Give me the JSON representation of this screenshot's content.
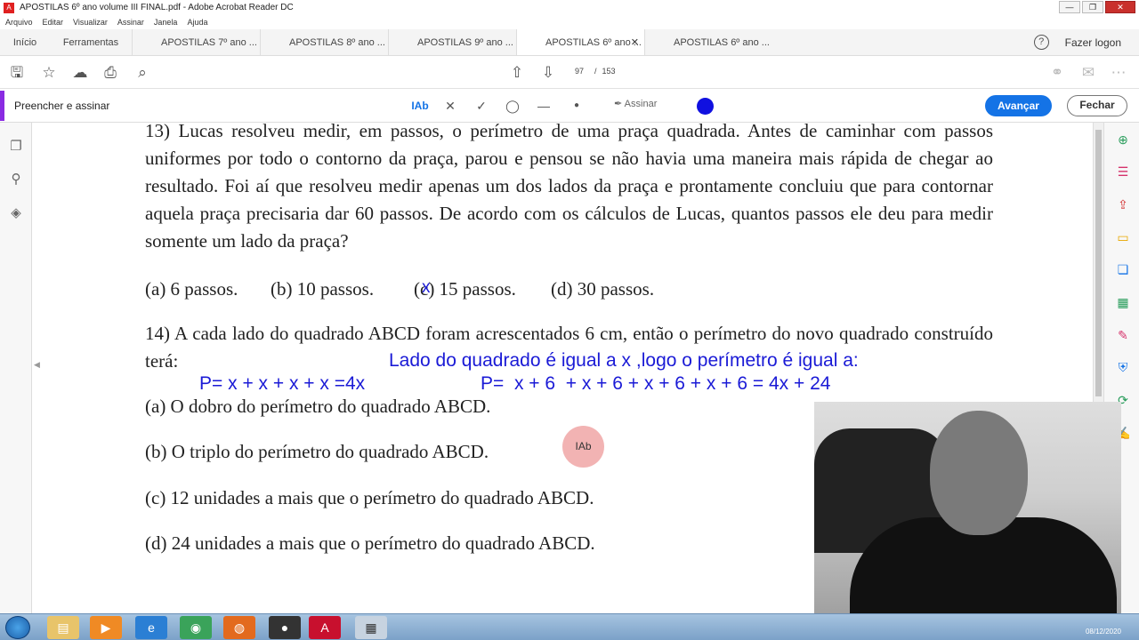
{
  "window": {
    "title": "APOSTILAS 6º ano volume III FINAL.pdf - Adobe Acrobat Reader DC",
    "buttons": [
      "—",
      "❐",
      "✕"
    ]
  },
  "menu": [
    "Arquivo",
    "Editar",
    "Visualizar",
    "Assinar",
    "Janela",
    "Ajuda"
  ],
  "tabs": {
    "home": "Início",
    "tools": "Ferramentas",
    "docs": [
      "APOSTILAS 7º ano ...",
      "APOSTILAS 8º ano ...",
      "APOSTILAS 9º ano ...",
      "APOSTILAS 6º ano ...",
      "APOSTILAS 6º ano ..."
    ],
    "help": "?",
    "login": "Fazer logon"
  },
  "pager": {
    "current": "97",
    "separator": "/",
    "total": "153"
  },
  "fill_sign": {
    "label": "Preencher e assinar",
    "text_tool": "Ab",
    "sign_label": "Assinar",
    "next_button": "Avançar",
    "close_button": "Fechar",
    "ink_color": "#1010e0"
  },
  "document": {
    "q13": "13) Lucas resolveu medir, em passos, o perímetro de uma praça quadrada. Antes de caminhar com passos uniformes por todo o contorno da praça, parou e pensou se não havia uma maneira mais rápida de chegar ao resultado. Foi aí que resolveu medir apenas um dos lados da praça e prontamente concluiu que para contornar aquela praça precisaria dar 60 passos. De acordo com os cálculos de Lucas, quantos passos ele deu para medir somente um lado da praça?",
    "q13_options": [
      "(a) 6 passos.",
      "(b) 10 passos.",
      "(c) 15 passos.",
      "(d) 30 passos."
    ],
    "q13_mark": "x",
    "q14": "14) A cada lado do quadrado ABCD foram acrescentados 6 cm, então o perímetro do novo quadrado construído terá:",
    "q14_options": [
      "(a) O dobro do perímetro do quadrado ABCD.",
      "(b) O triplo do perímetro do quadrado ABCD.",
      "(c) 12 unidades a mais que o perímetro do quadrado ABCD.",
      "(d) 24 unidades a mais que o perímetro do quadrado ABCD."
    ],
    "annotation_line1": "Lado do quadrado é igual a x ,logo o perímetro é igual a:",
    "annotation_line2a": "P= x + x + x + x =4x",
    "annotation_line2b": "P=  x + 6  + x + 6 + x + 6 + x + 6 = 4x + 24"
  },
  "cursor_label": "Ab",
  "taskbar": {
    "apps": [
      "file-explorer",
      "media-player",
      "internet-explorer",
      "chrome",
      "firefox",
      "obs",
      "acrobat",
      "calculator"
    ],
    "clock": "08/12/2020"
  }
}
